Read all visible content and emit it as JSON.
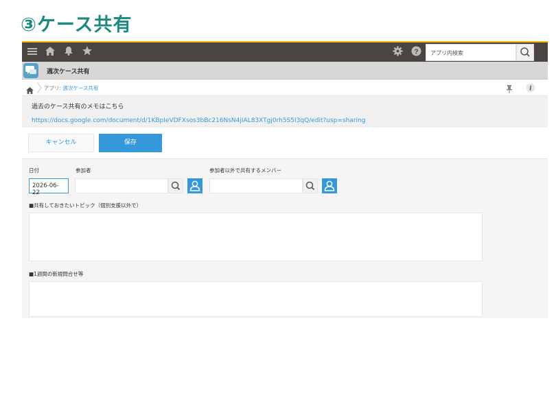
{
  "slide": {
    "title": "③ケース共有"
  },
  "header": {
    "icons": [
      "menu-icon",
      "home-icon",
      "bell-icon",
      "star-icon",
      "gear-icon",
      "help-icon"
    ],
    "search_placeholder": "アプリ内検索"
  },
  "app": {
    "title": "週次ケース共有"
  },
  "breadcrumb": {
    "prefix": "アプリ:",
    "link": "週次ケース共有"
  },
  "notice": {
    "text": "過去のケース共有のメモはこちら",
    "link": "https://docs.google.com/document/d/1KBpIeVDFXsos3bBc216NsN4jIAL83XTgj0rh5S5I3qQ/edit?usp=sharing"
  },
  "actions": {
    "cancel": "キャンセル",
    "save": "保存"
  },
  "form": {
    "date_label": "日付",
    "date_value": "2026-06-22",
    "participants_label": "参加者",
    "others_label": "参加者以外で共有するメンバー",
    "topic_label": "■共有しておきたいトピック（個別支援以外で）",
    "inquiry_label": "■1週間の新規問合せ等"
  },
  "colors": {
    "accent": "#3498db",
    "header": "#4a4543",
    "title": "#1b8a7f",
    "topline": "#f5b800"
  }
}
